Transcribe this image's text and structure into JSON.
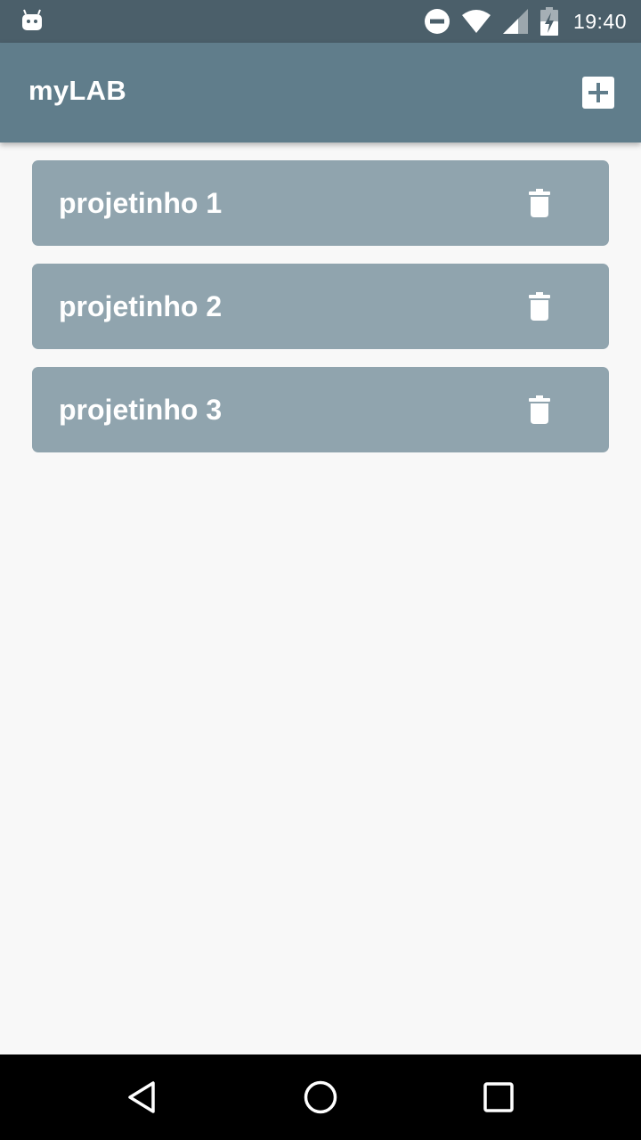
{
  "status_bar": {
    "time": "19:40",
    "icons": [
      "android-debug-icon",
      "do-not-disturb-icon",
      "wifi-icon",
      "signal-icon",
      "battery-charging-icon"
    ]
  },
  "app_bar": {
    "title": "myLAB",
    "add_icon": "add-box-icon"
  },
  "projects": [
    {
      "name": "projetinho 1",
      "action_icon": "trash-icon"
    },
    {
      "name": "projetinho 2",
      "action_icon": "trash-icon"
    },
    {
      "name": "projetinho 3",
      "action_icon": "trash-icon"
    }
  ],
  "nav_bar": {
    "icons": [
      "back-icon",
      "home-icon",
      "recents-icon"
    ]
  },
  "colors": {
    "status_bar": "#4b5f6a",
    "app_bar": "#607d8b",
    "card": "#90a4ae",
    "background": "#f8f8f8",
    "nav_bar": "#000000"
  }
}
